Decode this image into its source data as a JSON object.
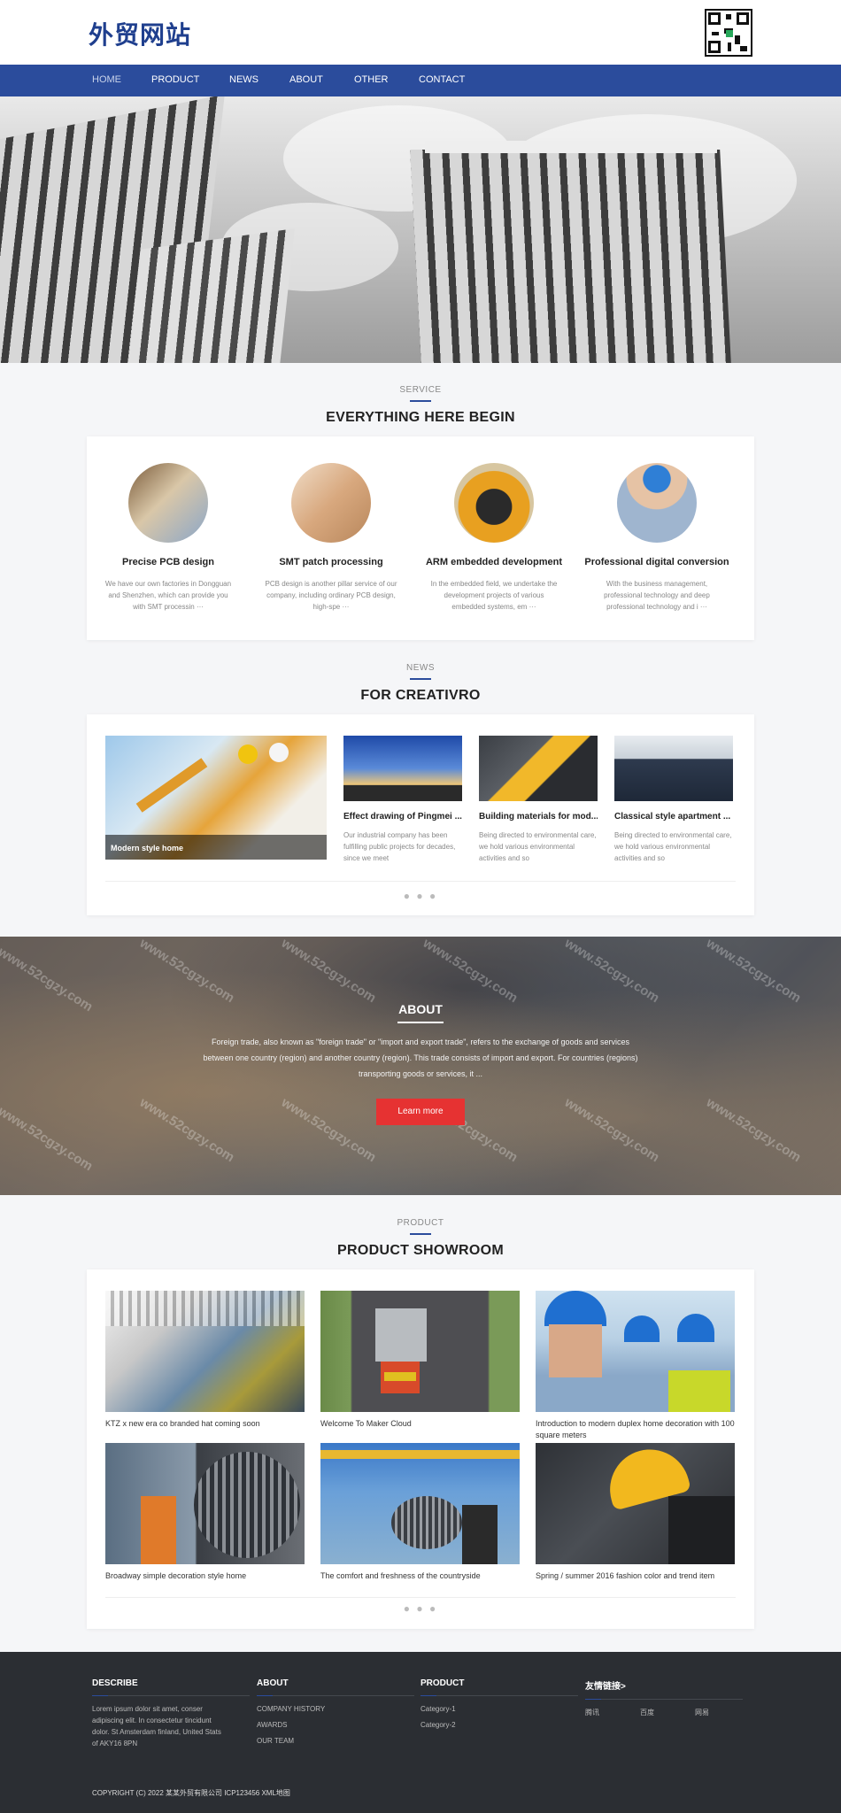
{
  "header": {
    "logo": "外贸网站"
  },
  "nav": {
    "items": [
      "HOME",
      "PRODUCT",
      "NEWS",
      "ABOUT",
      "OTHER",
      "CONTACT"
    ]
  },
  "service": {
    "sub": "SERVICE",
    "title": "EVERYTHING HERE BEGIN",
    "items": [
      {
        "title": "Precise PCB design",
        "desc": "We have our own factories in Dongguan and Shenzhen, which can provide you with SMT processin ···"
      },
      {
        "title": "SMT patch processing",
        "desc": "PCB design is another pillar service of our company, including ordinary PCB design, high-spe ···"
      },
      {
        "title": "ARM embedded development",
        "desc": "In the embedded field, we undertake the development projects of various embedded systems, em ···"
      },
      {
        "title": "Professional digital conversion",
        "desc": "With the business management, professional technology and deep professional technology and i ···"
      }
    ]
  },
  "news": {
    "sub": "NEWS",
    "title": "FOR CREATIVRO",
    "featured": "Modern style home",
    "items": [
      {
        "title": "Effect drawing of Pingmei ...",
        "desc": "Our industrial company has been fulfilling public projects for decades, since we meet"
      },
      {
        "title": "Building materials for mod...",
        "desc": "Being directed to environmental care, we hold various environmental activities and so"
      },
      {
        "title": "Classical style apartment ...",
        "desc": "Being directed to environmental care, we hold various environmental activities and so"
      }
    ],
    "dots": "● ● ●"
  },
  "about": {
    "title": "ABOUT",
    "text": "Foreign trade, also known as \"foreign trade\" or \"import and export trade\", refers to the exchange of goods and services between one country (region) and another country (region). This trade consists of import and export. For countries (regions) transporting goods or services, it ...",
    "button": "Learn more",
    "watermark": "www.52cgzy.com"
  },
  "product": {
    "sub": "PRODUCT",
    "title": "PRODUCT SHOWROOM",
    "items": [
      "KTZ x new era co branded hat coming soon",
      "Welcome To Maker Cloud",
      "Introduction to modern duplex home decoration with 100 square meters",
      "Broadway simple decoration style home",
      "The comfort and freshness of the countryside",
      "Spring / summer 2016 fashion color and trend item"
    ],
    "dots": "● ● ●"
  },
  "footer": {
    "describe": {
      "title": "DESCRIBE",
      "text": "Lorem ipsum dolor sit amet, conser adipiscing elit. In consectetur tincidunt dolor. St Amsterdam finland, United Stats of AKY16 8PN"
    },
    "about": {
      "title": "ABOUT",
      "links": [
        "COMPANY HISTORY",
        "AWARDS",
        "OUR TEAM"
      ]
    },
    "product": {
      "title": "PRODUCT",
      "links": [
        "Category-1",
        "Category-2"
      ]
    },
    "friends": {
      "title": "友情链接>",
      "links": [
        "腾讯",
        "百度",
        "网易"
      ]
    },
    "copyright": "COPYRIGHT (C) 2022 某某外贸有限公司 ICP123456 XML地图"
  },
  "colors": {
    "brand": "#2b4c9c",
    "button": "#e63232",
    "footer_bg": "#2b2e33"
  }
}
